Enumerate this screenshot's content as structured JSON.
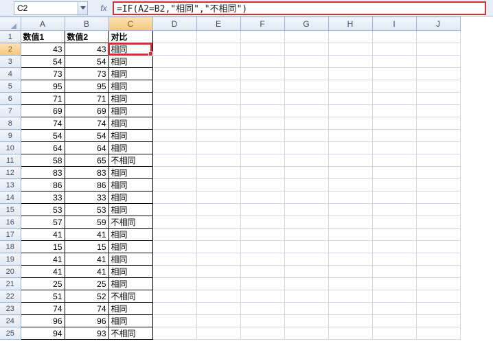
{
  "nameBox": "C2",
  "fxLabel": "fx",
  "formula": "=IF(A2=B2,\"相同\",\"不相同\")",
  "columns": [
    "A",
    "B",
    "C",
    "D",
    "E",
    "F",
    "G",
    "H",
    "I",
    "J"
  ],
  "headers": {
    "A": "数值1",
    "B": "数值2",
    "C": "对比"
  },
  "rows": [
    {
      "n": 2,
      "a": 43,
      "b": 43,
      "c": "相同"
    },
    {
      "n": 3,
      "a": 54,
      "b": 54,
      "c": "相同"
    },
    {
      "n": 4,
      "a": 73,
      "b": 73,
      "c": "相同"
    },
    {
      "n": 5,
      "a": 95,
      "b": 95,
      "c": "相同"
    },
    {
      "n": 6,
      "a": 71,
      "b": 71,
      "c": "相同"
    },
    {
      "n": 7,
      "a": 69,
      "b": 69,
      "c": "相同"
    },
    {
      "n": 8,
      "a": 74,
      "b": 74,
      "c": "相同"
    },
    {
      "n": 9,
      "a": 54,
      "b": 54,
      "c": "相同"
    },
    {
      "n": 10,
      "a": 64,
      "b": 64,
      "c": "相同"
    },
    {
      "n": 11,
      "a": 58,
      "b": 65,
      "c": "不相同"
    },
    {
      "n": 12,
      "a": 83,
      "b": 83,
      "c": "相同"
    },
    {
      "n": 13,
      "a": 86,
      "b": 86,
      "c": "相同"
    },
    {
      "n": 14,
      "a": 33,
      "b": 33,
      "c": "相同"
    },
    {
      "n": 15,
      "a": 53,
      "b": 53,
      "c": "相同"
    },
    {
      "n": 16,
      "a": 57,
      "b": 59,
      "c": "不相同"
    },
    {
      "n": 17,
      "a": 41,
      "b": 41,
      "c": "相同"
    },
    {
      "n": 18,
      "a": 15,
      "b": 15,
      "c": "相同"
    },
    {
      "n": 19,
      "a": 41,
      "b": 41,
      "c": "相同"
    },
    {
      "n": 20,
      "a": 41,
      "b": 41,
      "c": "相同"
    },
    {
      "n": 21,
      "a": 25,
      "b": 25,
      "c": "相同"
    },
    {
      "n": 22,
      "a": 51,
      "b": 52,
      "c": "不相同"
    },
    {
      "n": 23,
      "a": 74,
      "b": 74,
      "c": "相同"
    },
    {
      "n": 24,
      "a": 96,
      "b": 96,
      "c": "相同"
    },
    {
      "n": 25,
      "a": 94,
      "b": 93,
      "c": "不相同"
    }
  ],
  "activeCell": {
    "row": 2,
    "col": "C"
  }
}
